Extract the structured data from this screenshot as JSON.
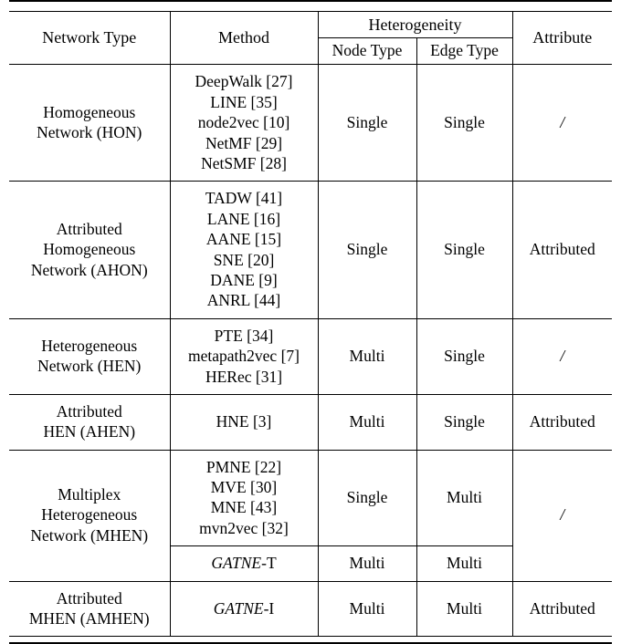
{
  "table": {
    "header": {
      "network_type": "Network Type",
      "method": "Method",
      "heterogeneity": "Heterogeneity",
      "node_type": "Node Type",
      "edge_type": "Edge Type",
      "attribute": "Attribute"
    },
    "rows": [
      {
        "network_type": [
          "Homogeneous",
          "Network (HON)"
        ],
        "methods": [
          "DeepWalk [27]",
          "LINE [35]",
          "node2vec [10]",
          "NetMF [29]",
          "NetSMF [28]"
        ],
        "node_type": "Single",
        "edge_type": "Single",
        "attribute": "/"
      },
      {
        "network_type": [
          "Attributed",
          "Homogeneous",
          "Network (AHON)"
        ],
        "methods": [
          "TADW [41]",
          "LANE [16]",
          "AANE [15]",
          "SNE [20]",
          "DANE [9]",
          "ANRL [44]"
        ],
        "node_type": "Single",
        "edge_type": "Single",
        "attribute": "Attributed"
      },
      {
        "network_type": [
          "Heterogeneous",
          "Network (HEN)"
        ],
        "methods": [
          "PTE [34]",
          "metapath2vec [7]",
          "HERec [31]"
        ],
        "node_type": "Multi",
        "edge_type": "Single",
        "attribute": "/"
      },
      {
        "network_type": [
          "Attributed",
          "HEN (AHEN)"
        ],
        "methods": [
          "HNE [3]"
        ],
        "node_type": "Multi",
        "edge_type": "Single",
        "attribute": "Attributed"
      },
      {
        "network_type": [
          "Multiplex",
          "Heterogeneous",
          "Network (MHEN)"
        ],
        "methods": [
          "PMNE [22]",
          "MVE [30]",
          "MNE [43]",
          "mvn2vec [32]"
        ],
        "node_type": "Single",
        "edge_type": "Multi",
        "attribute": "/",
        "subrow": {
          "method_italic": "GATNE",
          "method_suffix": "-T",
          "node_type": "Multi",
          "edge_type": "Multi"
        }
      },
      {
        "network_type": [
          "Attributed",
          "MHEN (AMHEN)"
        ],
        "method_italic": "GATNE",
        "method_suffix": "-I",
        "node_type": "Multi",
        "edge_type": "Multi",
        "attribute": "Attributed"
      }
    ]
  }
}
